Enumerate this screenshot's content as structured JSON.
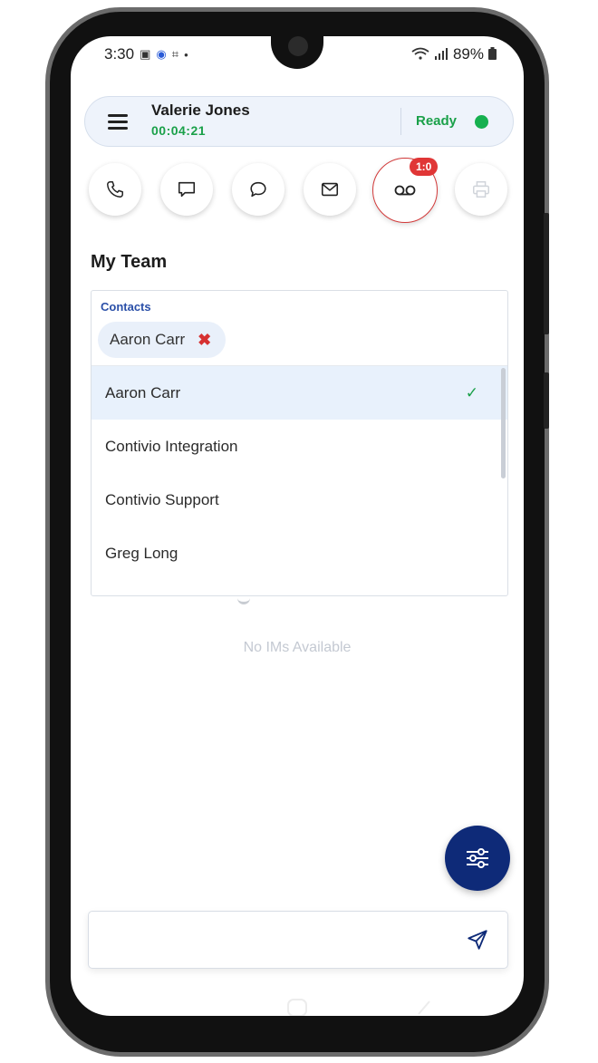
{
  "status_bar": {
    "time": "3:30",
    "battery": "89%"
  },
  "header": {
    "agent_name": "Valerie Jones",
    "timer": "00:04:21",
    "status": "Ready",
    "status_color": "#16b04f"
  },
  "channels": {
    "items": [
      "phone-icon",
      "chat-square-icon",
      "chat-bubble-icon",
      "email-icon",
      "voicemail-icon",
      "print-icon"
    ],
    "voicemail_badge": "1:0"
  },
  "section_title": "My Team",
  "contacts": {
    "label": "Contacts",
    "selected_chip": "Aaron Carr",
    "options": [
      {
        "label": "Aaron Carr",
        "selected": true
      },
      {
        "label": "Contivio Integration",
        "selected": false
      },
      {
        "label": "Contivio Support",
        "selected": false
      },
      {
        "label": "Greg Long",
        "selected": false
      }
    ]
  },
  "empty_state": "No IMs Available",
  "composer": {
    "placeholder": ""
  },
  "colors": {
    "accent": "#0e2a78",
    "ready": "#1aa049",
    "badge": "#e03636"
  }
}
